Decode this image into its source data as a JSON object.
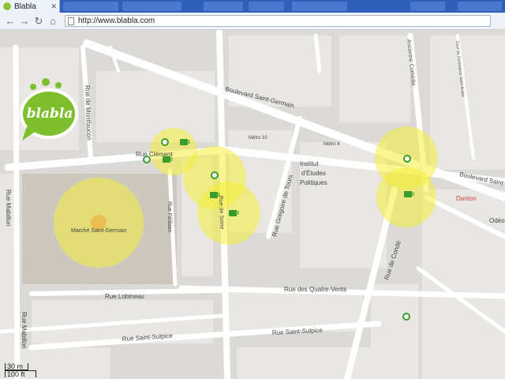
{
  "browser": {
    "tab_title": "Blabla",
    "url": "http://www.blabla.com"
  },
  "logo": {
    "text": "blabla"
  },
  "map": {
    "labels": {
      "bd_saint_germain": "Boulevard Saint-Germain",
      "bd_saint_germain_2": "Boulevard Saint-Germain",
      "rue_clement": "Rue Clément",
      "rue_mabillon": "Rue Mabillon",
      "rue_mabillon_2": "Rue Mabillon",
      "rue_montfaucon": "Rue de Montfaucon",
      "marche": "Marché Saint-Germain",
      "rue_felibien": "Rue Félibien",
      "rue_seine": "Rue de Seine",
      "rue_gregoire": "Rue Grégoire de Tours",
      "institut": "Institut",
      "institut2": "d'Études",
      "institut3": "Politiques",
      "metro10": "Métro 10",
      "metro4": "Métro 4",
      "ancienne_comedie": "Ancienne Comédie",
      "commerce_st_andre": "Cour du Commerce Saint-André",
      "rue_lobineau": "Rue Lobineau",
      "rue_quatre_vents": "Rue des Quatre-Vents",
      "rue_conde": "Rue de Condé",
      "rue_st_sulpice": "Rue Saint-Sulpice",
      "rue_st_sulpice_2": "Rue Saint-Sulpice",
      "danton": "Danton",
      "odeon": "Odéo"
    },
    "scale": {
      "metric": "30 m",
      "imperial": "100 ft"
    }
  },
  "colors": {
    "hotspot": "#f4ef3a",
    "marker_green": "#3a9d2b",
    "logo_green": "#7fbf2e"
  }
}
